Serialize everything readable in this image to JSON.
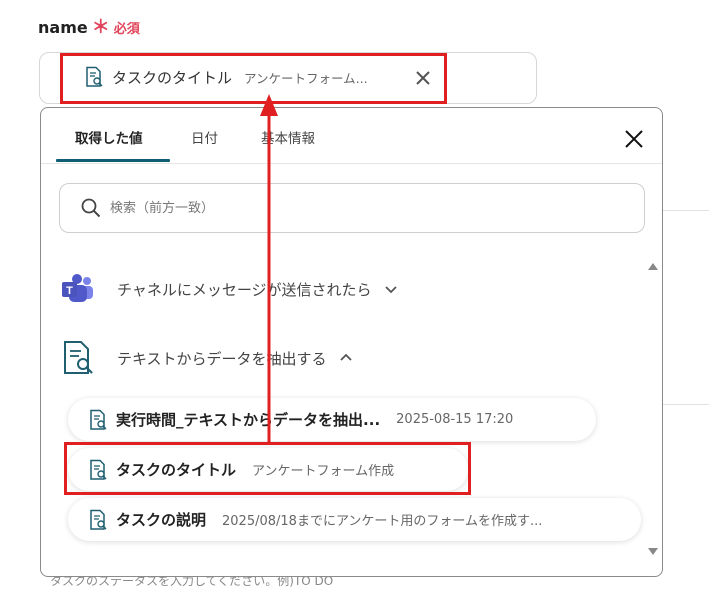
{
  "field": {
    "label": "name",
    "required_mark": "＊",
    "required_text": "必須",
    "selected_chip": {
      "title": "タスクのタイトル",
      "subtitle": "アンケートフォーム..."
    },
    "helper_text": "タスクのステータスを入力してください。例)TO DO"
  },
  "popover": {
    "tabs": [
      {
        "label": "取得した値",
        "active": true
      },
      {
        "label": "日付",
        "active": false
      },
      {
        "label": "基本情報",
        "active": false
      }
    ],
    "search": {
      "placeholder": "検索（前方一致）"
    },
    "groups": [
      {
        "label": "チャネルにメッセージが送信されたら",
        "icon": "teams-icon",
        "expanded": false
      },
      {
        "label": "テキストからデータを抽出する",
        "icon": "document-search-icon",
        "expanded": true
      }
    ],
    "items": [
      {
        "title": "実行時間_テキストからデータを抽出...",
        "value": "2025-08-15 17:20"
      },
      {
        "title": "タスクのタイトル",
        "value": "アンケートフォーム作成"
      },
      {
        "title": "タスクの説明",
        "value": "2025/08/18までにアンケート用のフォームを作成す..."
      }
    ]
  },
  "colors": {
    "accent": "#0f5e74",
    "required": "#e0455b",
    "highlight": "#e02020",
    "teams": "#5059c9"
  }
}
